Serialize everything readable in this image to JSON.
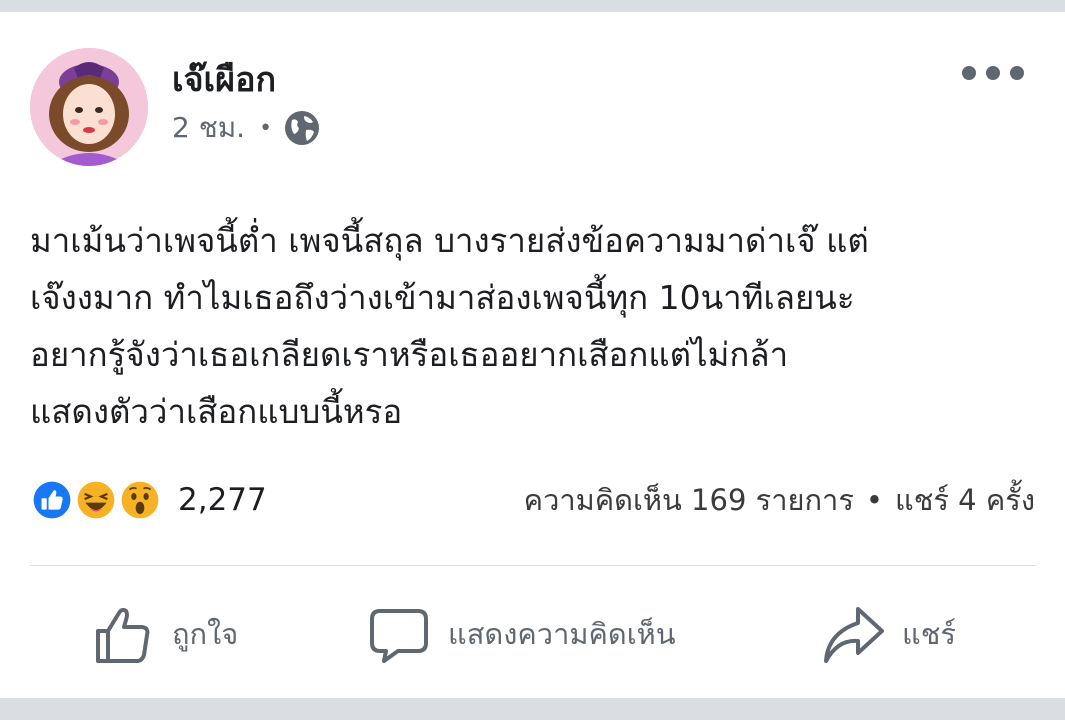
{
  "post": {
    "author": "เจ๊เผือก",
    "time": "2 ชม.",
    "separator": "•",
    "text_lines": [
      "มาเม้นว่าเพจนี้ต่ำ เพจนี้สถุล บางรายส่งข้อความมาด่าเจ๊ แต่",
      "เจ๊งงมาก ทำไมเธอถึงว่างเข้ามาส่องเพจนี้ทุก 10นาทีเลยนะ",
      "อยากรู้จังว่าเธอเกลียดเราหรือเธออยากเสือกแต่ไม่กล้า",
      "แสดงตัวว่าเสือกแบบนี้หรอ"
    ]
  },
  "reactions": {
    "count": "2,277",
    "icons": [
      "like-icon",
      "haha-icon",
      "wow-icon"
    ],
    "colors": {
      "like": "#1877f2",
      "emoji": "#f7b125"
    }
  },
  "stats": {
    "comments": "ความคิดเห็น 169 รายการ",
    "separator": "•",
    "shares": "แชร์ 4 ครั้ง"
  },
  "actions": {
    "like_label": "ถูกใจ",
    "comment_label": "แสดงความคิดเห็น",
    "share_label": "แชร์"
  }
}
